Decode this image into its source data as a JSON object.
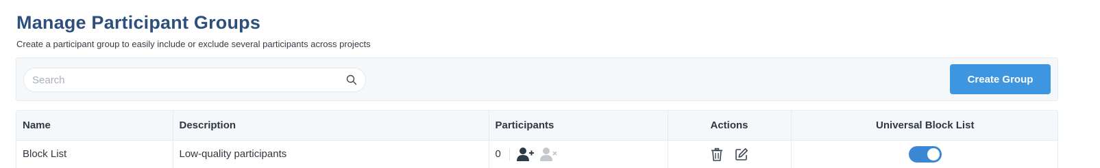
{
  "header": {
    "title": "Manage Participant Groups",
    "subtitle": "Create a participant group to easily include or exclude several participants across projects"
  },
  "toolbar": {
    "search_placeholder": "Search",
    "search_value": "",
    "create_button_label": "Create Group",
    "accent_color": "#3f96e0"
  },
  "table": {
    "columns": [
      "Name",
      "Description",
      "Participants",
      "Actions",
      "Universal Block List"
    ],
    "rows": [
      {
        "name": "Block List",
        "description": "Low-quality participants",
        "participants": "0",
        "universal_block_list": true
      }
    ]
  },
  "icons": [
    "search-icon",
    "add-user-icon",
    "remove-user-icon",
    "trash-icon",
    "edit-icon"
  ]
}
